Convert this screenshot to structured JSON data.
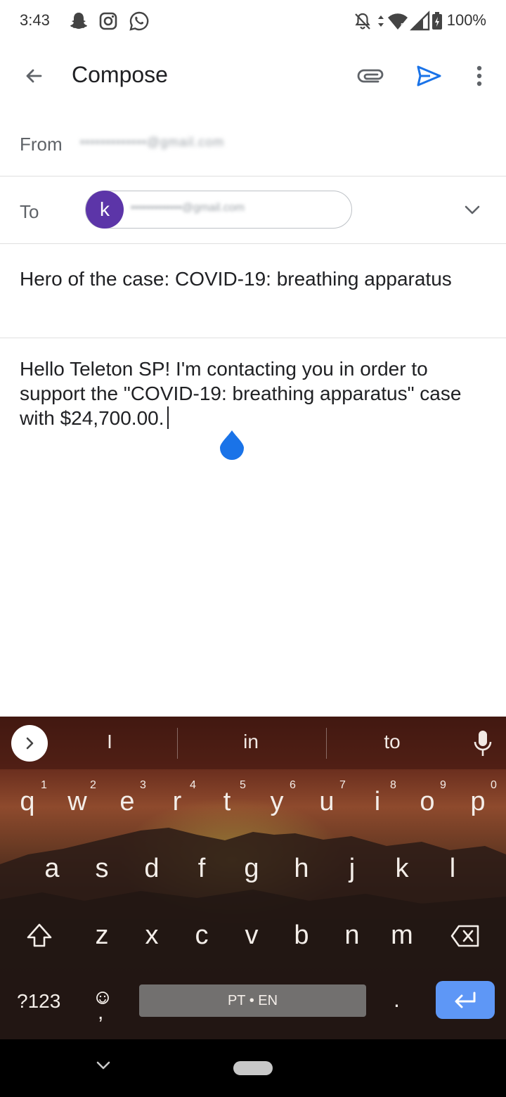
{
  "status_bar": {
    "time": "3:43",
    "battery": "100%",
    "icons": [
      "snapchat-icon",
      "instagram-icon",
      "whatsapp-icon",
      "bell-off-icon",
      "data-arrows-icon",
      "wifi-icon",
      "signal-icon",
      "battery-charging-icon"
    ]
  },
  "app_bar": {
    "title": "Compose",
    "back_icon": "arrow-left-icon",
    "attach_icon": "paperclip-icon",
    "send_icon": "send-icon",
    "more_icon": "more-vertical-icon",
    "accent": "#1a73e8"
  },
  "from": {
    "label": "From",
    "value": "•••••••••••••@gmail.com"
  },
  "to": {
    "label": "To",
    "recipient_initial": "k",
    "recipient_email": "•••••••••••••@gmail.com",
    "avatar_color": "#5c35a8"
  },
  "subject": "Hero of the case: COVID-19: breathing apparatus",
  "body": "Hello Teleton SP! I'm contacting you in order to support the \"COVID-19: breathing apparatus\" case with $24,700.00.",
  "keyboard": {
    "suggestions": [
      "I",
      "in",
      "to"
    ],
    "row1": [
      "q",
      "w",
      "e",
      "r",
      "t",
      "y",
      "u",
      "i",
      "o",
      "p"
    ],
    "row1_hints": [
      "1",
      "2",
      "3",
      "4",
      "5",
      "6",
      "7",
      "8",
      "9",
      "0"
    ],
    "row2": [
      "a",
      "s",
      "d",
      "f",
      "g",
      "h",
      "j",
      "k",
      "l"
    ],
    "row3": [
      "z",
      "x",
      "c",
      "v",
      "b",
      "n",
      "m"
    ],
    "symbols_key": "?123",
    "comma_key": ",",
    "space_label": "PT • EN",
    "period_key": ".",
    "enter_color": "#5e97f6"
  }
}
